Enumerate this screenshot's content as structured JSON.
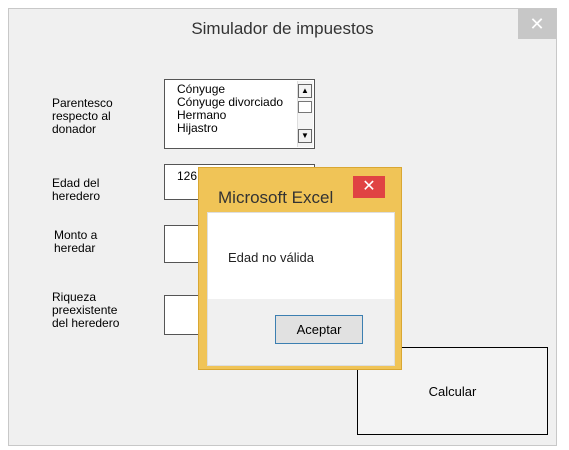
{
  "window": {
    "title": "Simulador de impuestos",
    "close_glyph": "✕"
  },
  "form": {
    "labels": {
      "parentesco": "Parentesco\nrespecto al\ndonador",
      "edad": "Edad del\nheredero",
      "monto": "Monto a\nheredar",
      "riqueza": "Riqueza\npreexistente\ndel heredero"
    },
    "parentesco_options": [
      "Cónyuge",
      "Cónyuge divorciado",
      "Hermano",
      "Hijastro"
    ],
    "edad_value": "126",
    "monto_value": "",
    "riqueza_value": "",
    "calcular_label": "Calcular"
  },
  "msgbox": {
    "title": "Microsoft Excel",
    "close_glyph": "✕",
    "message": "Edad no válida",
    "ok_label": "Aceptar"
  },
  "colors": {
    "dialog_frame": "#f0c457",
    "close_red": "#e04343",
    "form_bg": "#f0f0f0"
  }
}
